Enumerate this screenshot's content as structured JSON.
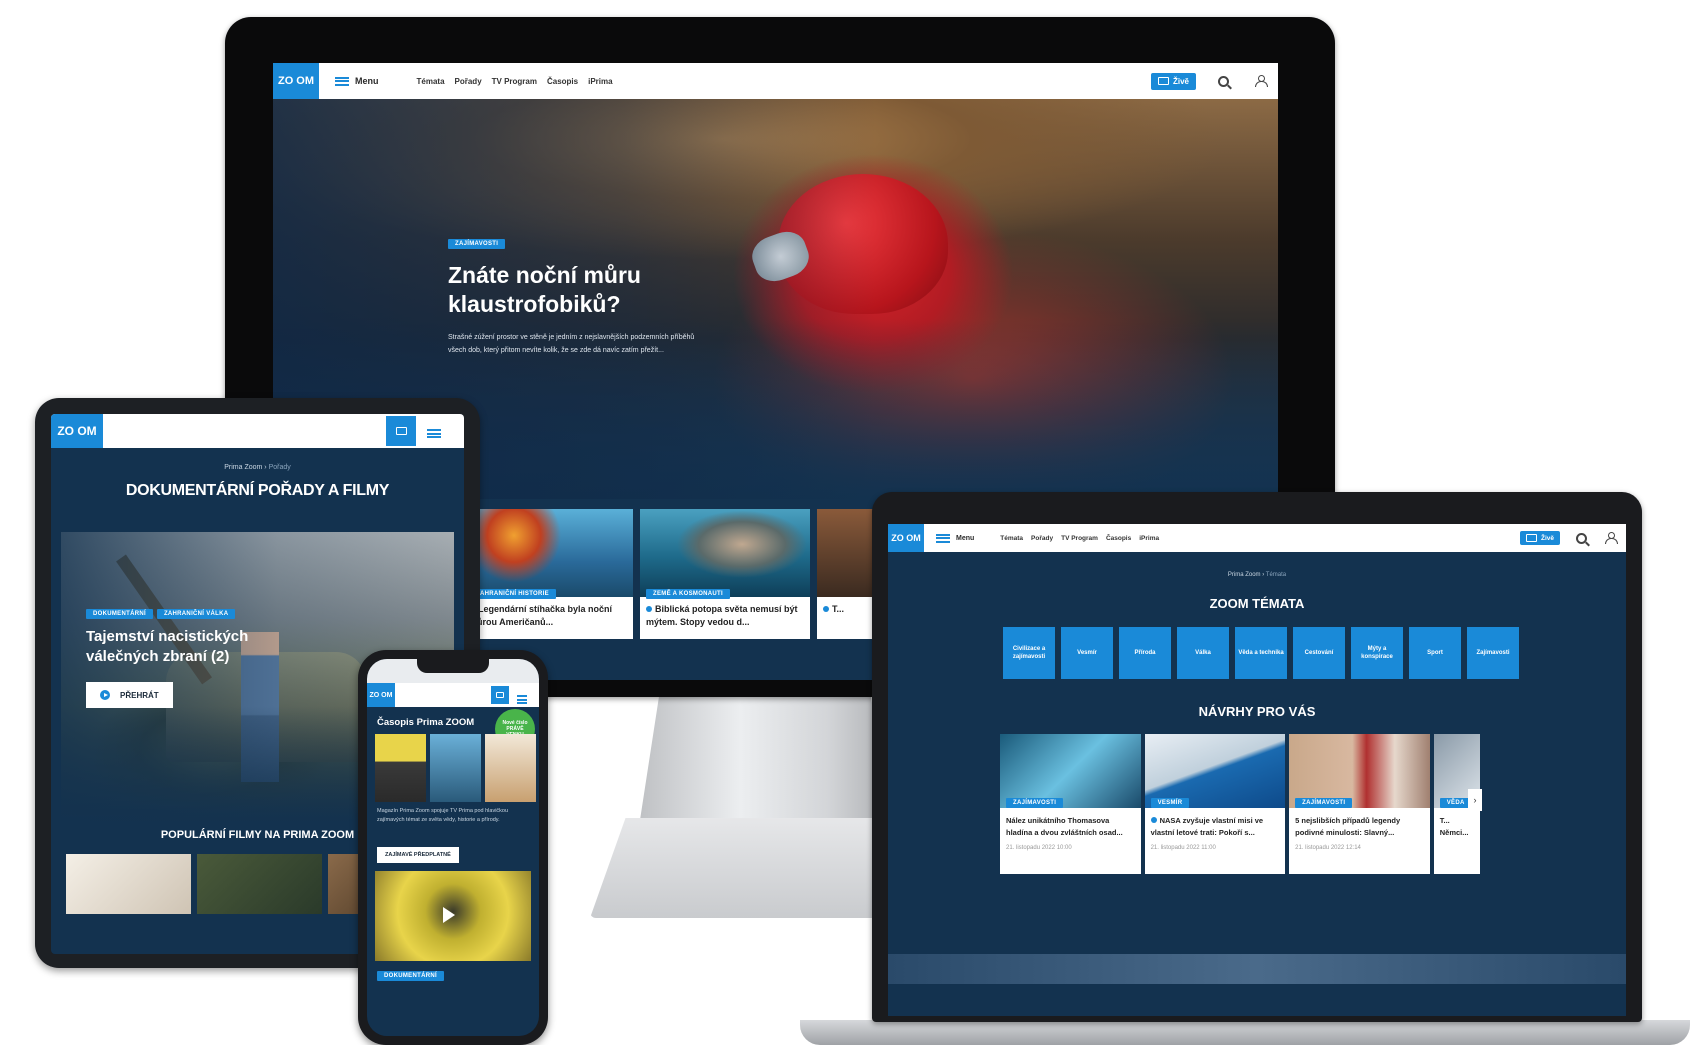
{
  "brand": {
    "logo_text": "ZO OM",
    "accent": "#1a8ad8",
    "navy": "#13324f"
  },
  "desktop": {
    "nav": {
      "menu_label": "Menu",
      "links": [
        "Témata",
        "Pořady",
        "TV Program",
        "Časopis",
        "iPrima"
      ],
      "live_label": "Živě"
    },
    "hero": {
      "tag": "Zajímavosti",
      "title": "Znáte noční můru klaustrofobiků?",
      "description": "Strašné zúžení prostor ve stěně je jedním z nejslavnějších podzemních příběhů všech dob, který přitom nevíte kolik, že se zde dá navíc zatím přežít..."
    },
    "cards": [
      {
        "tag": "Zahraniční historie",
        "title": "Legendární stíhačka byla noční můrou Američanů..."
      },
      {
        "tag": "Země a kosmonauti",
        "title": "Biblická potopa světa nemusí být mýtem. Stopy vedou d..."
      },
      {
        "tag": "",
        "title": "T..."
      }
    ]
  },
  "tablet": {
    "breadcrumb": [
      "Prima Zoom",
      "Pořady"
    ],
    "page_title": "DOKUMENTÁRNÍ POŘADY A FILMY",
    "hero": {
      "tags": [
        "Dokumentární",
        "Zahraniční válka"
      ],
      "title": "Tajemství nacistických válečných zbraní (2)",
      "button": "PŘEHRÁT"
    },
    "section_title": "POPULÁRNÍ FILMY NA PRIMA ZOOM"
  },
  "laptop": {
    "nav": {
      "menu_label": "Menu",
      "links": [
        "Témata",
        "Pořady",
        "TV Program",
        "Časopis",
        "iPrima"
      ],
      "live_label": "Živě"
    },
    "breadcrumb": [
      "Prima Zoom",
      "Témata"
    ],
    "topics_title": "ZOOM TÉMATA",
    "topics": [
      "Civilizace a zajímavosti",
      "Vesmír",
      "Příroda",
      "Válka",
      "Věda a technika",
      "Cestování",
      "Mýty a konspirace",
      "Sport",
      "Zajímavosti"
    ],
    "recs_title": "NÁVRHY PRO VÁS",
    "recs": [
      {
        "tag": "Zajímavosti",
        "title": "Nález unikátního Thomasova hladína a dvou zvláštních osad...",
        "date": "21. listopadu 2022 10:00"
      },
      {
        "tag": "Vesmír",
        "title": "NASA zvyšuje vlastní misi ve vlastní letové trati: Pokoří s...",
        "date": "21. listopadu 2022 11:00"
      },
      {
        "tag": "Zajímavosti",
        "title": "5 nejslibších případů legendy podivné minulosti: Slavný...",
        "date": "21. listopadu 2022 12:14"
      },
      {
        "tag": "Věda",
        "title": "T... Němci...",
        "date": ""
      }
    ]
  },
  "phone": {
    "magazine_title": "Časopis Prima ZOOM",
    "badge": "Nové číslo PRÁVĚ VENKU",
    "description": "Magazín Prima Zoom spojuje TV Prima pod hlavičkou zajímavých témat ze světa vědy, historie a přírody.",
    "button": "ZAJÍMAVÉ PŘEDPLATNÉ",
    "bottom_tag": "Dokumentární"
  }
}
